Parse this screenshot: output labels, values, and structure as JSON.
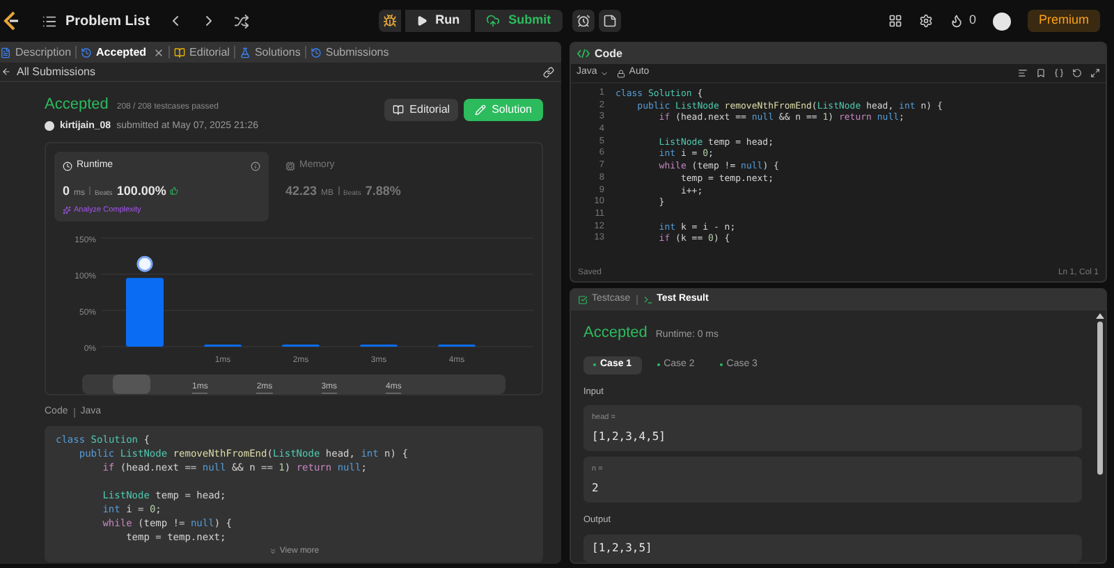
{
  "topbar": {
    "title": "Problem List",
    "run": "Run",
    "submit": "Submit",
    "streak": "0",
    "premium": "Premium"
  },
  "left_tabs": [
    {
      "label": "Description",
      "selected": false,
      "closable": false
    },
    {
      "label": "Accepted",
      "selected": true,
      "closable": true
    },
    {
      "label": "Editorial",
      "selected": false,
      "closable": false
    },
    {
      "label": "Solutions",
      "selected": false,
      "closable": false
    },
    {
      "label": "Submissions",
      "selected": false,
      "closable": false
    }
  ],
  "back_link": "All Submissions",
  "submission": {
    "status": "Accepted",
    "passed": "208 / 208 testcases passed",
    "user": "kirtijain_08",
    "submitted": "submitted at May 07, 2025 21:26",
    "editorial_button": "Editorial",
    "solution_button": "Solution"
  },
  "runtime": {
    "label": "Runtime",
    "value": "0",
    "unit": "ms",
    "beats_label": "Beats",
    "beats": "100.00%",
    "analyze": "Analyze Complexity"
  },
  "memory": {
    "label": "Memory",
    "value": "42.23",
    "unit": "MB",
    "beats_label": "Beats",
    "beats": "7.88%"
  },
  "chart_data": {
    "type": "bar",
    "categories": [
      null,
      "1ms",
      "2ms",
      "3ms",
      "4ms"
    ],
    "values": [
      95,
      3,
      3,
      3,
      3
    ],
    "ylim": [
      0,
      150
    ],
    "yticks": [
      {
        "value": 0,
        "label": "0%"
      },
      {
        "value": 50,
        "label": "50%"
      },
      {
        "value": 100,
        "label": "100%"
      },
      {
        "value": 150,
        "label": "150%"
      }
    ]
  },
  "range_labels": [
    "1ms",
    "2ms",
    "3ms",
    "4ms"
  ],
  "code_section": {
    "label": "Code",
    "language": "Java",
    "view_more": "View more",
    "lines": [
      {
        "kind": "code",
        "tokens": [
          {
            "kind": "kw",
            "text": "class "
          },
          {
            "kind": "type",
            "text": "Solution"
          },
          {
            "kind": "plain",
            "text": " {"
          }
        ]
      },
      {
        "kind": "code",
        "tokens": [
          {
            "kind": "kw",
            "text": "    public "
          },
          {
            "kind": "type",
            "text": "ListNode "
          },
          {
            "kind": "fn",
            "text": "removeNthFromEnd"
          },
          {
            "kind": "plain",
            "text": "("
          },
          {
            "kind": "type",
            "text": "ListNode "
          },
          {
            "kind": "plain",
            "text": "head, "
          },
          {
            "kind": "kw",
            "text": "int "
          },
          {
            "kind": "plain",
            "text": "n) {"
          }
        ]
      },
      {
        "kind": "code",
        "tokens": [
          {
            "kind": "ctrl",
            "text": "        if "
          },
          {
            "kind": "plain",
            "text": "(head.next == "
          },
          {
            "kind": "kw",
            "text": "null"
          },
          {
            "kind": "plain",
            "text": " && n == "
          },
          {
            "kind": "num",
            "text": "1"
          },
          {
            "kind": "plain",
            "text": ") "
          },
          {
            "kind": "ctrl",
            "text": "return "
          },
          {
            "kind": "kw",
            "text": "null"
          },
          {
            "kind": "plain",
            "text": ";"
          }
        ]
      },
      {
        "kind": "blank"
      },
      {
        "kind": "code",
        "tokens": [
          {
            "kind": "type",
            "text": "        ListNode "
          },
          {
            "kind": "plain",
            "text": "temp = head;"
          }
        ]
      },
      {
        "kind": "code",
        "tokens": [
          {
            "kind": "kw",
            "text": "        int "
          },
          {
            "kind": "plain",
            "text": "i = "
          },
          {
            "kind": "num",
            "text": "0"
          },
          {
            "kind": "plain",
            "text": ";"
          }
        ]
      },
      {
        "kind": "code",
        "tokens": [
          {
            "kind": "ctrl",
            "text": "        while "
          },
          {
            "kind": "plain",
            "text": "(temp != "
          },
          {
            "kind": "kw",
            "text": "null"
          },
          {
            "kind": "plain",
            "text": ") {"
          }
        ]
      },
      {
        "kind": "code",
        "tokens": [
          {
            "kind": "plain",
            "text": "            temp = temp.next;"
          }
        ]
      }
    ]
  },
  "editor": {
    "title": "Code",
    "language": "Java",
    "mode": "Auto",
    "status": "Saved",
    "cursor": "Ln 1, Col 1",
    "lines": [
      {
        "num": "1",
        "kind": "code",
        "tokens": [
          {
            "kind": "kw",
            "text": "class "
          },
          {
            "kind": "type",
            "text": "Solution"
          },
          {
            "kind": "plain",
            "text": " {"
          }
        ]
      },
      {
        "num": "2",
        "kind": "code",
        "tokens": [
          {
            "kind": "kw",
            "text": "    public "
          },
          {
            "kind": "type",
            "text": "ListNode "
          },
          {
            "kind": "fn",
            "text": "removeNthFromEnd"
          },
          {
            "kind": "plain",
            "text": "("
          },
          {
            "kind": "type",
            "text": "ListNode "
          },
          {
            "kind": "plain",
            "text": "head, "
          },
          {
            "kind": "kw",
            "text": "int "
          },
          {
            "kind": "plain",
            "text": "n) {"
          }
        ]
      },
      {
        "num": "3",
        "kind": "code",
        "tokens": [
          {
            "kind": "ctrl",
            "text": "        if "
          },
          {
            "kind": "plain",
            "text": "(head.next == "
          },
          {
            "kind": "kw",
            "text": "null"
          },
          {
            "kind": "plain",
            "text": " && n == "
          },
          {
            "kind": "num",
            "text": "1"
          },
          {
            "kind": "plain",
            "text": ") "
          },
          {
            "kind": "ctrl",
            "text": "return "
          },
          {
            "kind": "kw",
            "text": "null"
          },
          {
            "kind": "plain",
            "text": ";"
          }
        ]
      },
      {
        "num": "4",
        "kind": "blank"
      },
      {
        "num": "5",
        "kind": "code",
        "tokens": [
          {
            "kind": "type",
            "text": "        ListNode "
          },
          {
            "kind": "plain",
            "text": "temp = head;"
          }
        ]
      },
      {
        "num": "6",
        "kind": "code",
        "tokens": [
          {
            "kind": "kw",
            "text": "        int "
          },
          {
            "kind": "plain",
            "text": "i = "
          },
          {
            "kind": "num",
            "text": "0"
          },
          {
            "kind": "plain",
            "text": ";"
          }
        ]
      },
      {
        "num": "7",
        "kind": "code",
        "tokens": [
          {
            "kind": "ctrl",
            "text": "        while "
          },
          {
            "kind": "plain",
            "text": "(temp != "
          },
          {
            "kind": "kw",
            "text": "null"
          },
          {
            "kind": "plain",
            "text": ") {"
          }
        ]
      },
      {
        "num": "8",
        "kind": "code",
        "tokens": [
          {
            "kind": "plain",
            "text": "            temp = temp.next;"
          }
        ]
      },
      {
        "num": "9",
        "kind": "code",
        "tokens": [
          {
            "kind": "plain",
            "text": "            i++;"
          }
        ]
      },
      {
        "num": "10",
        "kind": "code",
        "tokens": [
          {
            "kind": "plain",
            "text": "        }"
          }
        ]
      },
      {
        "num": "11",
        "kind": "blank"
      },
      {
        "num": "12",
        "kind": "code",
        "tokens": [
          {
            "kind": "kw",
            "text": "        int "
          },
          {
            "kind": "plain",
            "text": "k = i - n;"
          }
        ]
      },
      {
        "num": "13",
        "kind": "code",
        "tokens": [
          {
            "kind": "ctrl",
            "text": "        if "
          },
          {
            "kind": "plain",
            "text": "(k == "
          },
          {
            "kind": "num",
            "text": "0"
          },
          {
            "kind": "plain",
            "text": ") {"
          }
        ]
      }
    ]
  },
  "result_tabs": [
    {
      "label": "Testcase",
      "selected": false
    },
    {
      "label": "Test Result",
      "selected": true
    }
  ],
  "result": {
    "status": "Accepted",
    "runtime": "Runtime: 0 ms",
    "cases": [
      {
        "label": "Case 1",
        "selected": true
      },
      {
        "label": "Case 2",
        "selected": false
      },
      {
        "label": "Case 3",
        "selected": false
      }
    ],
    "input_label": "Input",
    "inputs": [
      {
        "name": "head =",
        "value": "[1,2,3,4,5]"
      },
      {
        "name": "n =",
        "value": "2"
      }
    ],
    "output_label": "Output",
    "output": "[1,2,3,5]"
  }
}
